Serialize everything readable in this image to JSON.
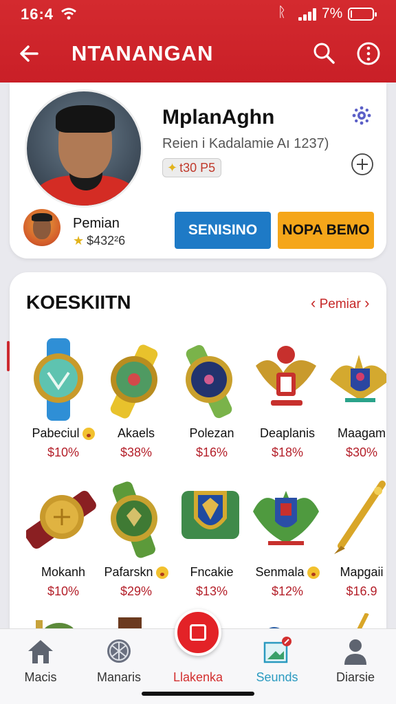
{
  "status_bar": {
    "time": "16:4",
    "battery": "7%",
    "battery_level": 0.07
  },
  "header": {
    "title": "NTANANGAN",
    "back_icon": "back-arrow-icon",
    "search_icon": "search-icon",
    "more_icon": "more-vertical-icon"
  },
  "profile": {
    "name": "MplanAghn",
    "subtitle": "Reien i Kadalamie Aı 1237)",
    "badge": "t30 P5",
    "mini_label": "Pemian",
    "mini_value": "$432²6",
    "primary_button": "SENISINO",
    "secondary_button": "NOPA BEMO"
  },
  "collection": {
    "title": "KOESKIITN",
    "link": "Pemiar",
    "items": [
      {
        "name": "Pabeciul",
        "price": "$10%",
        "emoji": true,
        "art": "watch-teal"
      },
      {
        "name": "Akaels",
        "price": "$38%",
        "emoji": false,
        "art": "watch-gold"
      },
      {
        "name": "Polezan",
        "price": "$16%",
        "emoji": false,
        "art": "watch-navy"
      },
      {
        "name": "Deaplanis",
        "price": "$18%",
        "emoji": false,
        "art": "garuda-emblem"
      },
      {
        "name": "Maagam",
        "price": "$30%",
        "emoji": false,
        "art": "shield-wings"
      },
      {
        "name": "Mokanh",
        "price": "$10%",
        "emoji": false,
        "art": "watch-red"
      },
      {
        "name": "Pafarskn",
        "price": "$29%",
        "emoji": true,
        "art": "watch-green"
      },
      {
        "name": "Fncakie",
        "price": "$13%",
        "emoji": false,
        "art": "shield-green"
      },
      {
        "name": "Senmala",
        "price": "$12%",
        "emoji": true,
        "art": "crest-wings"
      },
      {
        "name": "Mapgaii",
        "price": "$16.9",
        "emoji": false,
        "art": "golden-pen"
      }
    ]
  },
  "bottom_nav": {
    "tabs": [
      {
        "label": "Macis",
        "icon": "home-icon"
      },
      {
        "label": "Manaris",
        "icon": "ball-icon"
      },
      {
        "label": "Llakenka",
        "icon": "record-icon"
      },
      {
        "label": "Seunds",
        "icon": "image-edit-icon"
      },
      {
        "label": "Diarsie",
        "icon": "person-icon"
      }
    ]
  },
  "colors": {
    "brand_red": "#d42a2f",
    "blue": "#1e7ac6",
    "yellow": "#f5a61a",
    "price_red": "#b4202a"
  }
}
